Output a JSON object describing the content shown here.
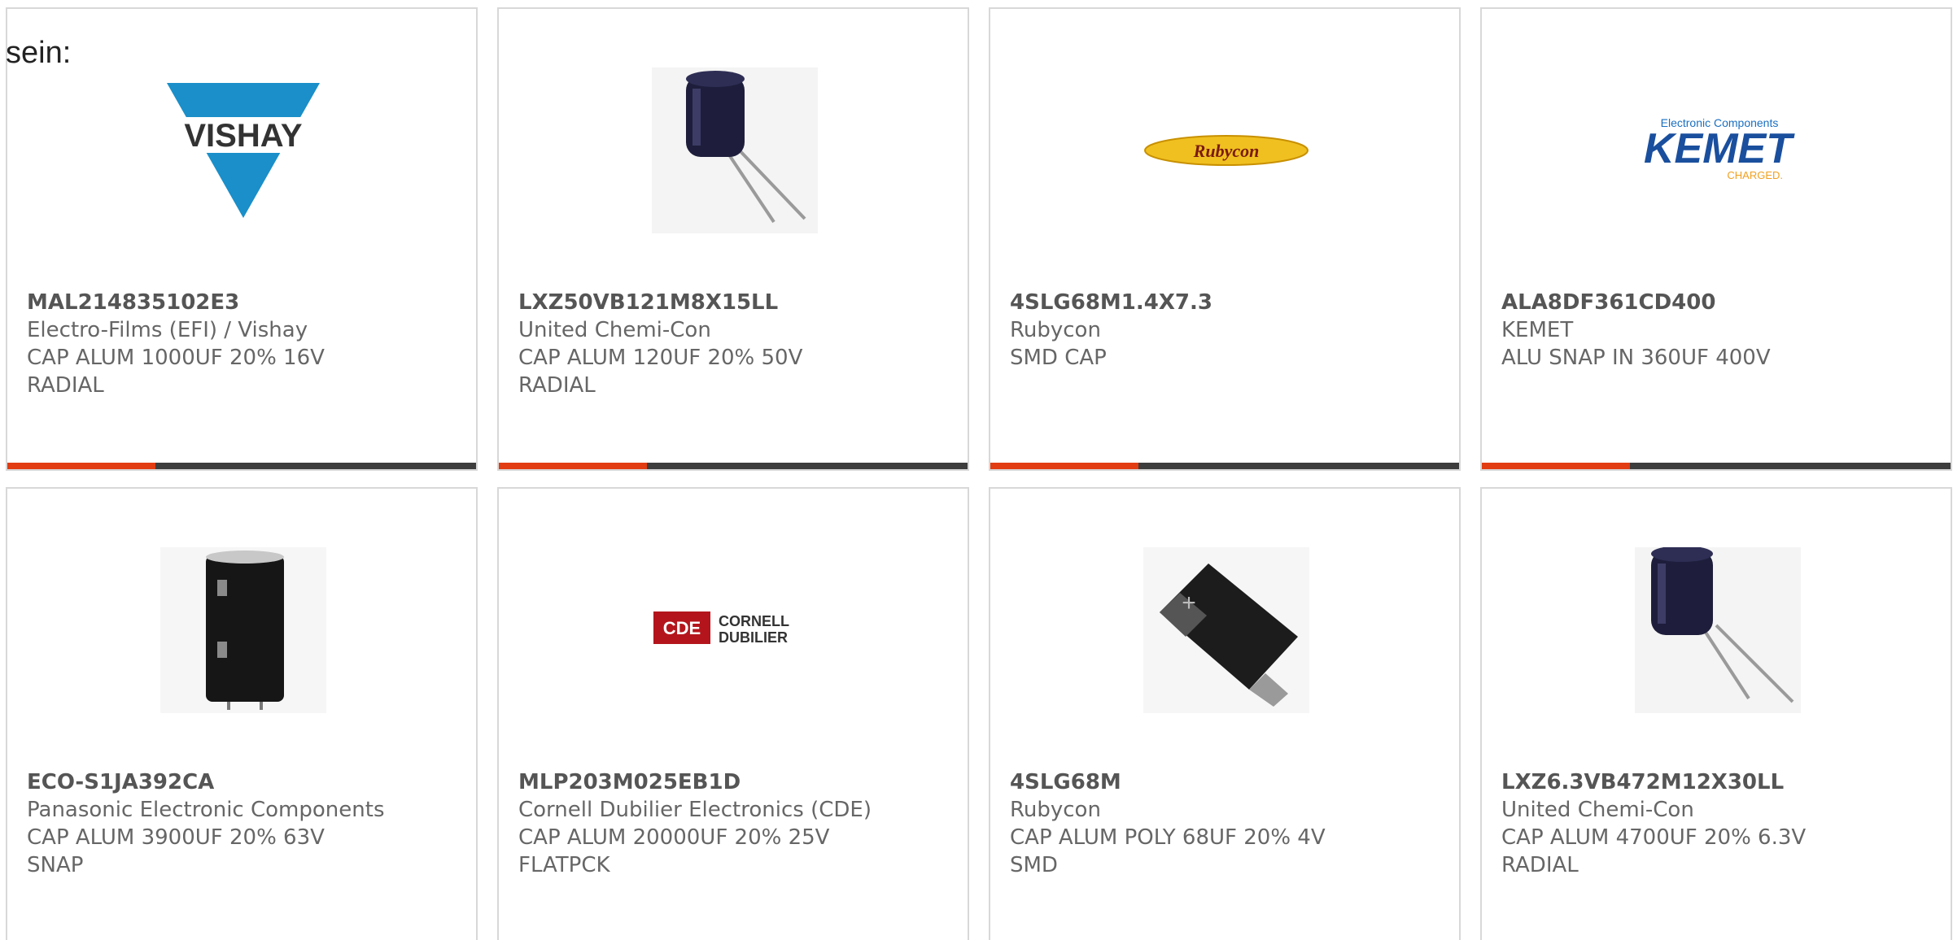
{
  "intro": "sein:",
  "accent_color": "#e13c12",
  "bar_color": "#3d3d3d",
  "cards": [
    {
      "pn": "MAL214835102E3",
      "mfr": "Electro-Films (EFI) / Vishay",
      "desc1": "CAP ALUM 1000UF 20% 16V",
      "desc2": "RADIAL",
      "logo": "VISHAY"
    },
    {
      "pn": "LXZ50VB121M8X15LL",
      "mfr": "United Chemi-Con",
      "desc1": "CAP ALUM 120UF 20% 50V",
      "desc2": "RADIAL"
    },
    {
      "pn": "4SLG68M1.4X7.3",
      "mfr": "Rubycon",
      "desc1": "SMD CAP",
      "desc2": "",
      "logo": "Rubycon"
    },
    {
      "pn": "ALA8DF361CD400",
      "mfr": "KEMET",
      "desc1": "ALU SNAP IN 360UF 400V",
      "desc2": "",
      "logo": "KEMET",
      "logo_top": "Electronic Components",
      "logo_sub": "CHARGED."
    },
    {
      "pn": "ECO-S1JA392CA",
      "mfr": "Panasonic Electronic Components",
      "desc1": "CAP ALUM 3900UF 20% 63V",
      "desc2": "SNAP"
    },
    {
      "pn": "MLP203M025EB1D",
      "mfr": "Cornell Dubilier Electronics (CDE)",
      "desc1": "CAP ALUM 20000UF 20% 25V",
      "desc2": "FLATPCK",
      "logo": "CDE",
      "logo_line1": "CORNELL",
      "logo_line2": "DUBILIER"
    },
    {
      "pn": "4SLG68M",
      "mfr": "Rubycon",
      "desc1": "CAP ALUM POLY 68UF 20% 4V",
      "desc2": "SMD"
    },
    {
      "pn": "LXZ6.3VB472M12X30LL",
      "mfr": "United Chemi-Con",
      "desc1": "CAP ALUM 4700UF 20% 6.3V",
      "desc2": "RADIAL"
    }
  ]
}
